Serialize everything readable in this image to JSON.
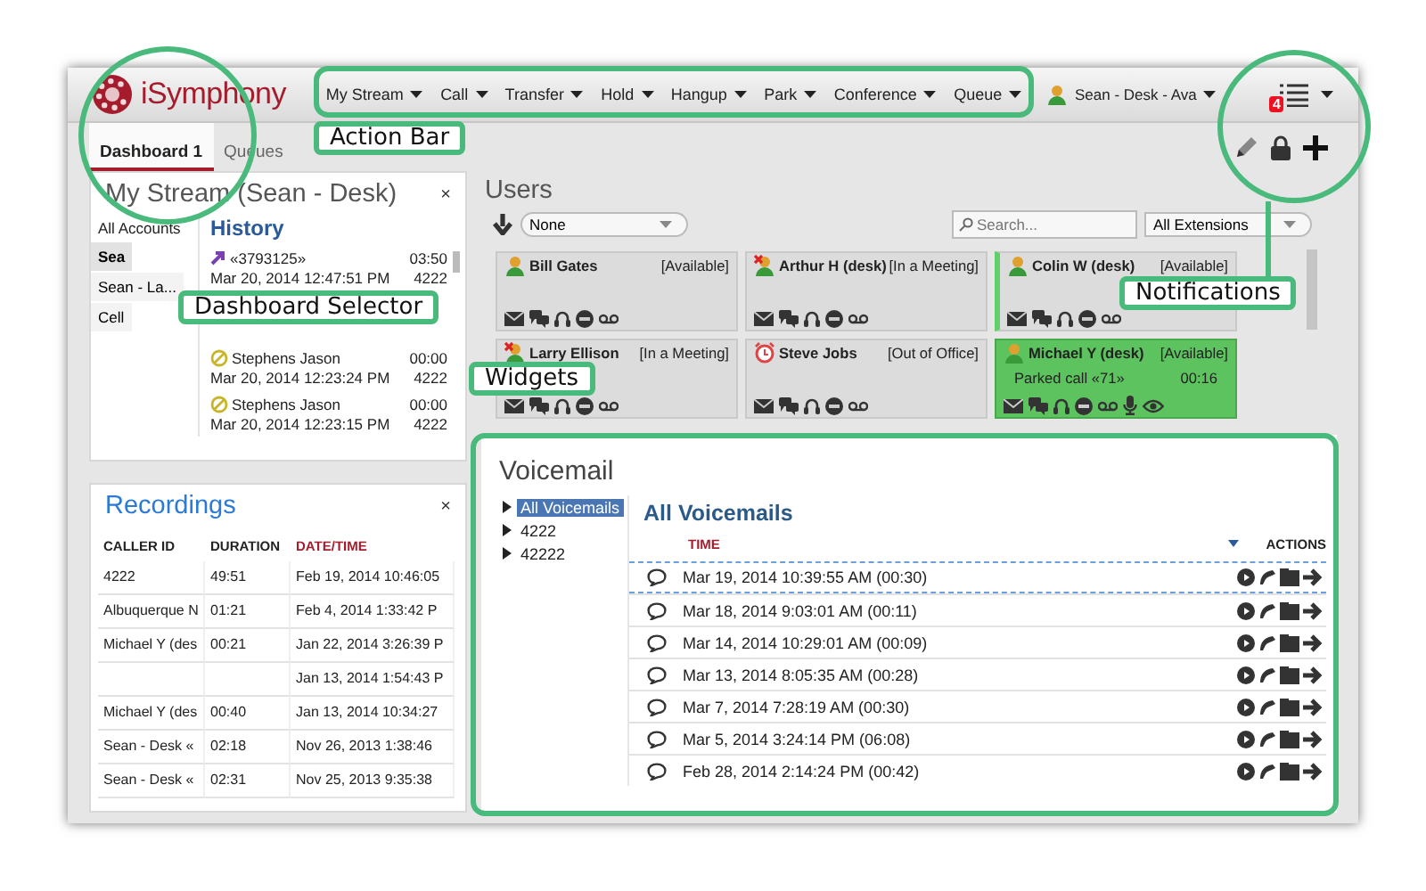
{
  "app": {
    "logo": "iSymphony"
  },
  "action_bar": [
    {
      "label": "My Stream"
    },
    {
      "label": "Call"
    },
    {
      "label": "Transfer"
    },
    {
      "label": "Hold"
    },
    {
      "label": "Hangup"
    },
    {
      "label": "Park"
    },
    {
      "label": "Conference"
    },
    {
      "label": "Queue"
    }
  ],
  "user_status": {
    "label": "Sean - Desk - Ava"
  },
  "notifications": {
    "count": "4"
  },
  "tabs": [
    {
      "label": "Dashboard 1",
      "selected": true
    },
    {
      "label": "Queues",
      "selected": false
    }
  ],
  "my_stream": {
    "title": "My Stream (Sean - Desk)",
    "close": "×",
    "accounts_header": "All Accounts",
    "accounts": [
      {
        "label": "Sea",
        "selected": true
      },
      {
        "label": "Sean - La...",
        "selected": false
      },
      {
        "label": "Cell",
        "selected": false
      }
    ],
    "history_title": "History",
    "history": [
      {
        "kind": "outgoing",
        "name": "«3793125»",
        "duration": "03:50",
        "time": "Mar 20, 2014 12:47:51 PM",
        "extension": "4222"
      },
      {
        "kind": "missed",
        "name": "Stephens Jason",
        "duration": "00:00",
        "time": "Mar 20, 2014 12:23:24 PM",
        "extension": "4222"
      },
      {
        "kind": "missed",
        "name": "Stephens Jason",
        "duration": "00:00",
        "time": "Mar 20, 2014 12:23:15 PM",
        "extension": "4222"
      }
    ]
  },
  "recordings": {
    "title": "Recordings",
    "close": "×",
    "columns": [
      {
        "label": "CALLER ID",
        "sorted": false
      },
      {
        "label": "DURATION",
        "sorted": false
      },
      {
        "label": "DATE/TIME",
        "sorted": true
      }
    ],
    "rows": [
      [
        "4222",
        "49:51",
        "Feb 19, 2014 10:46:05"
      ],
      [
        "Albuquerque N",
        "01:21",
        "Feb 4, 2014 1:33:42 P"
      ],
      [
        "Michael Y (des",
        "00:21",
        "Jan 22, 2014 3:26:39 P"
      ],
      [
        "",
        "",
        "Jan 13, 2014 1:54:43 P"
      ],
      [
        "Michael Y (des",
        "00:40",
        "Jan 13, 2014 10:34:27"
      ],
      [
        "Sean - Desk «",
        "02:18",
        "Nov 26, 2013 1:38:46"
      ],
      [
        "Sean - Desk «",
        "02:31",
        "Nov 25, 2013 9:35:38"
      ]
    ]
  },
  "users": {
    "title": "Users",
    "filter": "None",
    "search_placeholder": "Search...",
    "extensions": "All Extensions",
    "cards": [
      {
        "name": "Bill Gates",
        "status": "[Available]",
        "kind": "available",
        "highlighted": false,
        "active": false,
        "monitoring": false
      },
      {
        "name": "Arthur H (desk)",
        "status": "[In a Meeting]",
        "kind": "meeting",
        "highlighted": false,
        "active": false,
        "monitoring": false
      },
      {
        "name": "Colin W (desk)",
        "status": "[Available]",
        "kind": "available",
        "highlighted": true,
        "active": false,
        "monitoring": false
      },
      {
        "name": "Larry Ellison",
        "status": "[In a Meeting]",
        "kind": "meeting",
        "highlighted": false,
        "active": false,
        "monitoring": false
      },
      {
        "name": "Steve Jobs",
        "status": "[Out of Office]",
        "kind": "away",
        "highlighted": false,
        "active": false,
        "monitoring": false
      },
      {
        "name": "Michael Y (desk)",
        "status": "[Available]",
        "kind": "available",
        "highlighted": false,
        "active": true,
        "monitoring": true,
        "call": {
          "label": "Parked call «71»",
          "time": "00:16"
        }
      }
    ]
  },
  "voicemail": {
    "title": "Voicemail",
    "tree": [
      {
        "label": "All Voicemails",
        "selected": true
      },
      {
        "label": "4222",
        "selected": false
      },
      {
        "label": "42222",
        "selected": false
      }
    ],
    "list_title": "All Voicemails",
    "columns": [
      {
        "label": "TIME",
        "sorted": true
      },
      {
        "label": "ACTIONS",
        "sorted": false
      }
    ],
    "rows": [
      {
        "time": "Mar 19, 2014 10:39:55 AM (00:30)",
        "selected": true
      },
      {
        "time": "Mar 18, 2014 9:03:01 AM (00:11)",
        "selected": false
      },
      {
        "time": "Mar 14, 2014 10:29:01 AM (00:09)",
        "selected": false
      },
      {
        "time": "Mar 13, 2014 8:05:35 AM (00:28)",
        "selected": false
      },
      {
        "time": "Mar 7, 2014 7:28:19 AM (00:30)",
        "selected": false
      },
      {
        "time": "Mar 5, 2014 3:24:14 PM (06:08)",
        "selected": false
      },
      {
        "time": "Feb 28, 2014 2:14:24 PM (00:42)",
        "selected": false
      }
    ]
  },
  "callouts": [
    {
      "label": "Action Bar"
    },
    {
      "label": "Dashboard Selector"
    },
    {
      "label": "Widgets"
    },
    {
      "label": "Notifications"
    }
  ]
}
